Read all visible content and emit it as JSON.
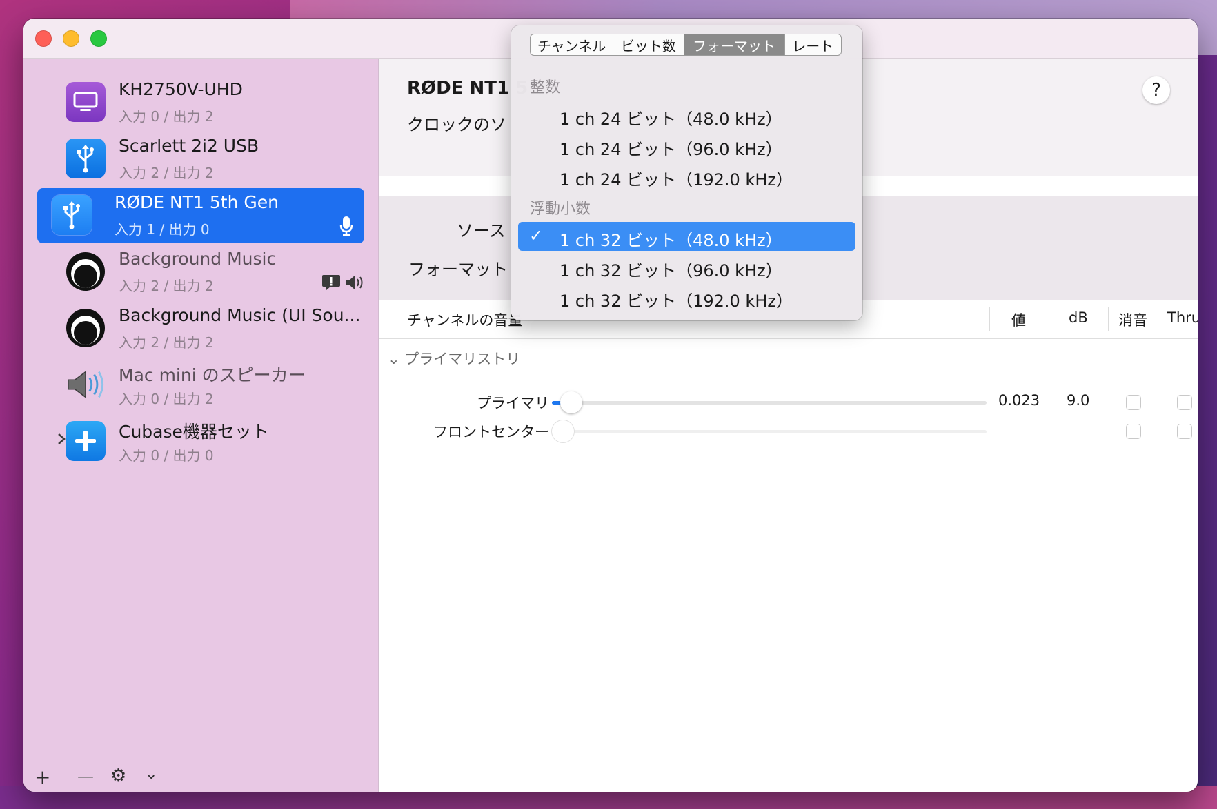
{
  "sidebar": {
    "devices": [
      {
        "name": "KH2750V-UHD",
        "io": "入力 0 / 出力 2",
        "icon": "display-icon"
      },
      {
        "name": "Scarlett 2i2 USB",
        "io": "入力 2 / 出力 2",
        "icon": "usb-icon"
      },
      {
        "name": "RØDE NT1 5th Gen",
        "io": "入力 1 / 出力 0",
        "icon": "usb-icon",
        "selected": true
      },
      {
        "name": "Background Music",
        "io": "入力 2 / 出力 2",
        "icon": "background-music-icon"
      },
      {
        "name": "Background Music (UI Sou...",
        "io": "入力 2 / 出力 2",
        "icon": "background-music-icon"
      },
      {
        "name": "Mac mini のスピーカー",
        "io": "入力 0 / 出力 2",
        "icon": "speaker-icon"
      },
      {
        "name": "Cubase機器セット",
        "io": "入力 0 / 出力 0",
        "icon": "aggregate-plus-icon"
      }
    ],
    "footer": {
      "add": "+",
      "remove": "—",
      "settings": "⚙",
      "more": "⌄"
    }
  },
  "main": {
    "title": "RØDE NT1 5",
    "clock_label": "クロックのソ",
    "help": "?",
    "source_label": "ソース",
    "format_label": "フォーマット",
    "table": {
      "channel_volume_label": "チャンネルの音量",
      "value_header": "値",
      "db_header": "dB",
      "mute_header": "消音",
      "thru_header": "Thru"
    },
    "group_label": "プライマリストリ",
    "channels": [
      {
        "label": "プライマリ",
        "value": "0.023",
        "db": "9.0",
        "level": 0.023
      },
      {
        "label": "フロントセンター",
        "value": "",
        "db": "",
        "level": 0
      }
    ]
  },
  "menu": {
    "tabs": [
      "チャンネル",
      "ビット数",
      "フォーマット",
      "レート"
    ],
    "active_tab": "フォーマット",
    "sections": [
      {
        "title": "整数",
        "items": [
          "1 ch 24 ビット（48.0 kHz）",
          "1 ch 24 ビット（96.0 kHz）",
          "1 ch 24 ビット（192.0 kHz）"
        ]
      },
      {
        "title": "浮動小数",
        "items": [
          "1 ch 32 ビット（48.0 kHz）",
          "1 ch 32 ビット（96.0 kHz）",
          "1 ch 32 ビット（192.0 kHz）"
        ]
      }
    ],
    "checkmark": "✓"
  },
  "colors": {
    "accent": "#1e6ff0",
    "menu_highlight": "#3b8ef5",
    "sidebar_bg": "#e8c8e4"
  }
}
